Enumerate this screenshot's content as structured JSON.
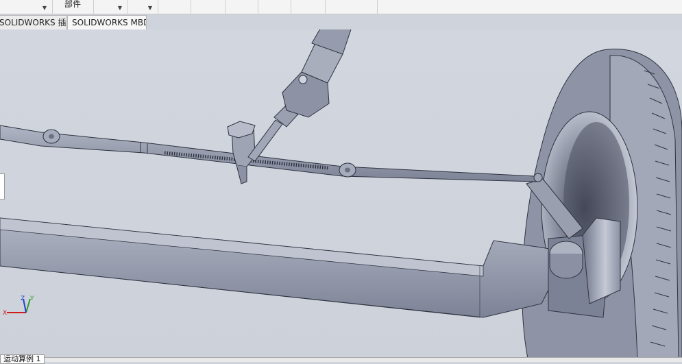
{
  "toolbar": {
    "dropdown_1": "",
    "dropdown_2_label": "部件",
    "dropdown_3": ""
  },
  "tabs": [
    {
      "label": "SOLIDWORKS 插件"
    },
    {
      "label": "SOLIDWORKS MBD"
    }
  ],
  "view_icons": [
    "zoom-to-fit-icon",
    "zoom-area-icon",
    "previous-view-icon",
    "section-view-icon",
    "dynamic-annotation-icon",
    "view-orientation-icon",
    "display-style-icon",
    "hide-show-items-icon",
    "edit-appearance-icon",
    "apply-scene-icon",
    "view-settings-icon"
  ],
  "triad": {
    "x": "X",
    "y": "Y",
    "z": "Z"
  },
  "bottom_tab": "运动算例 1",
  "colors": {
    "viewport_bg": "#cfd4dc",
    "model_fill": "#8d93a6",
    "model_dark": "#5d6375",
    "model_light": "#b4b9c8",
    "axis_x": "#d11a1a",
    "axis_y": "#2a9a2a",
    "axis_z": "#2244cc"
  }
}
